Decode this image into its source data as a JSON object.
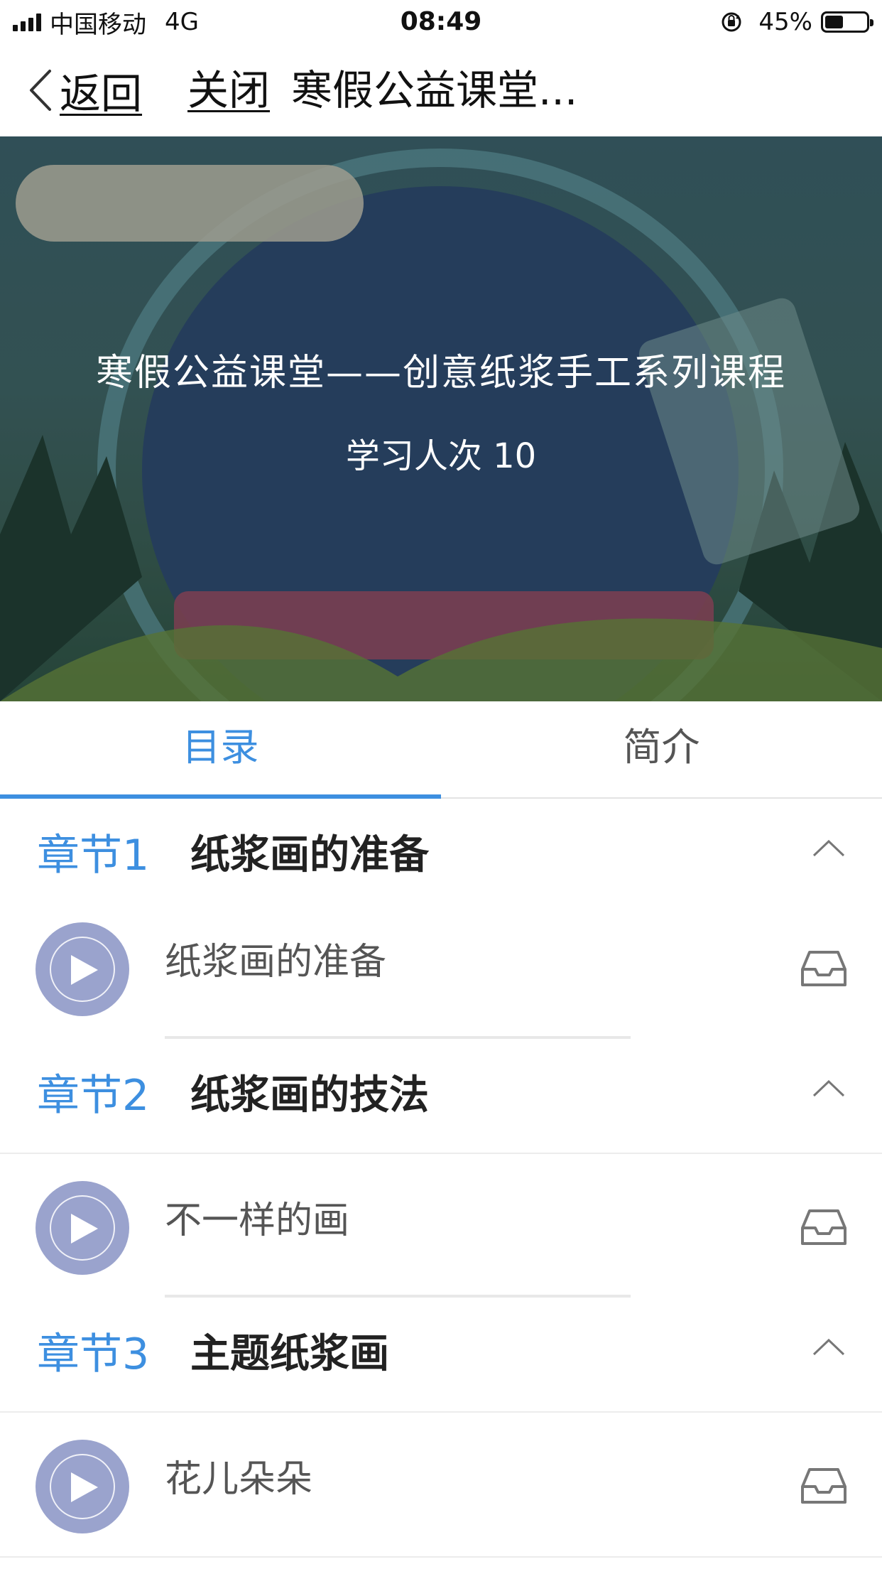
{
  "status_bar": {
    "carrier": "中国移动",
    "network": "4G",
    "time": "08:49",
    "battery": "45%",
    "battery_level": 0.45
  },
  "nav": {
    "back_label": "返回",
    "close_label": "关闭",
    "title": "寒假公益课堂..."
  },
  "banner": {
    "course_title": "寒假公益课堂——创意纸浆手工系列课程",
    "learners": "学习人次 10"
  },
  "tabs": [
    {
      "label": "目录",
      "active": true
    },
    {
      "label": "简介",
      "active": false
    }
  ],
  "chapters": [
    {
      "number": "章节1",
      "title": "纸浆画的准备",
      "lessons": [
        {
          "title": "纸浆画的准备"
        }
      ]
    },
    {
      "number": "章节2",
      "title": "纸浆画的技法",
      "lessons": [
        {
          "title": "不一样的画"
        }
      ]
    },
    {
      "number": "章节3",
      "title": "主题纸浆画",
      "lessons": [
        {
          "title": "花儿朵朵"
        }
      ]
    }
  ],
  "colors": {
    "accent": "#3d8fe0",
    "play_button": "#9aa3cd"
  }
}
